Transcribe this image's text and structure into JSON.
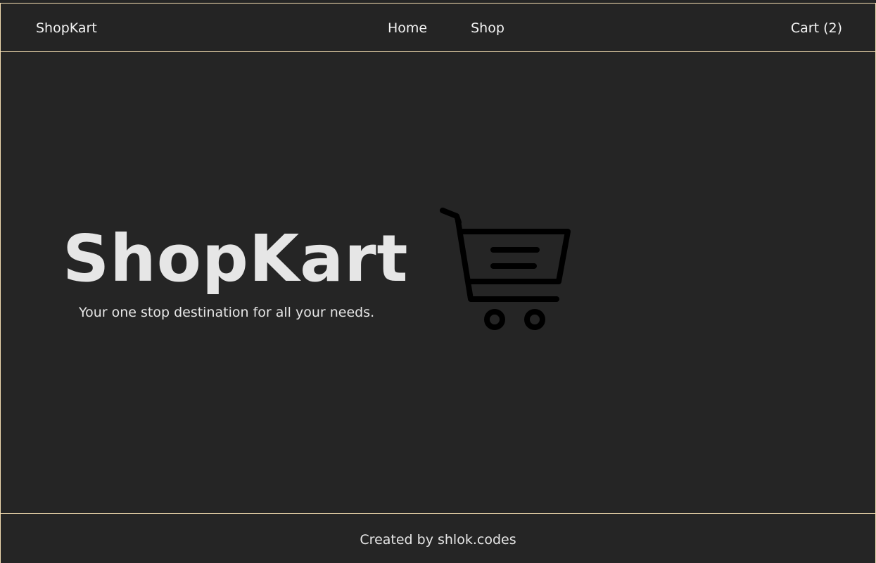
{
  "header": {
    "brand": "ShopKart",
    "nav": {
      "home": "Home",
      "shop": "Shop"
    },
    "cart": "Cart (2)"
  },
  "hero": {
    "title": "ShopKart",
    "subtitle": "Your one stop destination for all your needs.",
    "illustration_icon": "shopping-cart-icon"
  },
  "footer": {
    "text": "Created by shlok.codes"
  },
  "colors": {
    "background": "#252525",
    "border_accent": "#f3ddb1",
    "text": "#f4f4f4",
    "cart_icon": "#000000"
  }
}
